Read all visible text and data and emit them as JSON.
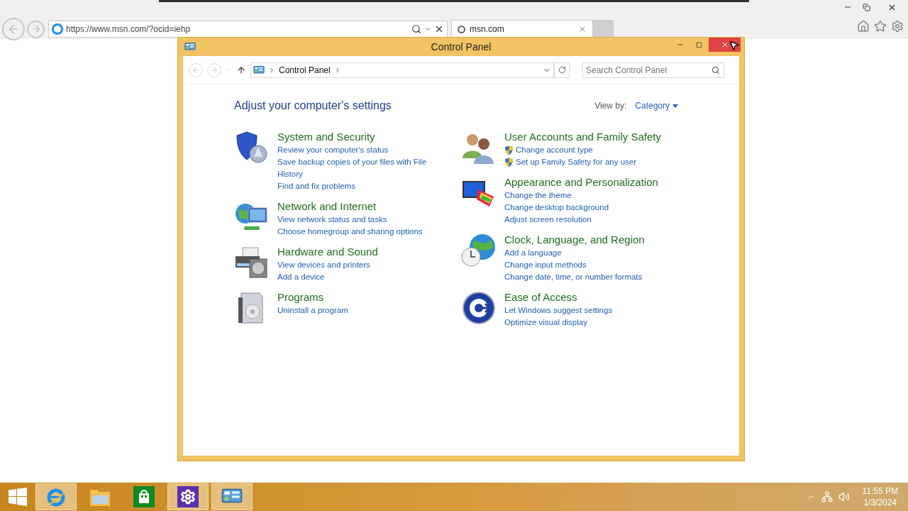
{
  "browser": {
    "address": "https://www.msn.com/?ocid=iehp",
    "tabs": [
      {
        "label": "msn.com",
        "selected": true
      }
    ]
  },
  "window": {
    "title": "Control Panel",
    "breadcrumb": "Control Panel",
    "search": {
      "placeholder": "Search Control Panel"
    }
  },
  "heading": "Adjust your computer's settings",
  "view_by": {
    "label": "View by:",
    "value": "Category"
  },
  "categories": [
    {
      "kind": "security",
      "title": "System and Security",
      "links": [
        {
          "text": "Review your computer's status",
          "shield": false
        },
        {
          "text": "Save backup copies of your files with File History",
          "shield": false
        },
        {
          "text": "Find and fix problems",
          "shield": false
        }
      ]
    },
    {
      "kind": "network",
      "title": "Network and Internet",
      "links": [
        {
          "text": "View network status and tasks",
          "shield": false
        },
        {
          "text": "Choose homegroup and sharing options",
          "shield": false
        }
      ]
    },
    {
      "kind": "hardware",
      "title": "Hardware and Sound",
      "links": [
        {
          "text": "View devices and printers",
          "shield": false
        },
        {
          "text": "Add a device",
          "shield": false
        }
      ]
    },
    {
      "kind": "programs",
      "title": "Programs",
      "links": [
        {
          "text": "Uninstall a program",
          "shield": false
        }
      ]
    },
    {
      "kind": "accounts",
      "title": "User Accounts and Family Safety",
      "links": [
        {
          "text": "Change account type",
          "shield": true
        },
        {
          "text": "Set up Family Safety for any user",
          "shield": true
        }
      ]
    },
    {
      "kind": "appearance",
      "title": "Appearance and Personalization",
      "links": [
        {
          "text": "Change the theme",
          "shield": false
        },
        {
          "text": "Change desktop background",
          "shield": false
        },
        {
          "text": "Adjust screen resolution",
          "shield": false
        }
      ]
    },
    {
      "kind": "clock",
      "title": "Clock, Language, and Region",
      "links": [
        {
          "text": "Add a language",
          "shield": false
        },
        {
          "text": "Change input methods",
          "shield": false
        },
        {
          "text": "Change date, time, or number formats",
          "shield": false
        }
      ]
    },
    {
      "kind": "access",
      "title": "Ease of Access",
      "links": [
        {
          "text": "Let Windows suggest settings",
          "shield": false
        },
        {
          "text": "Optimize visual display",
          "shield": false
        }
      ]
    }
  ],
  "taskbar": {
    "items": [
      {
        "kind": "ie",
        "running": true
      },
      {
        "kind": "explorer",
        "running": false
      },
      {
        "kind": "store",
        "running": false
      },
      {
        "kind": "settings",
        "running": true
      },
      {
        "kind": "control",
        "running": true
      }
    ],
    "time": "11:55 PM",
    "date": "1/3/2024"
  }
}
